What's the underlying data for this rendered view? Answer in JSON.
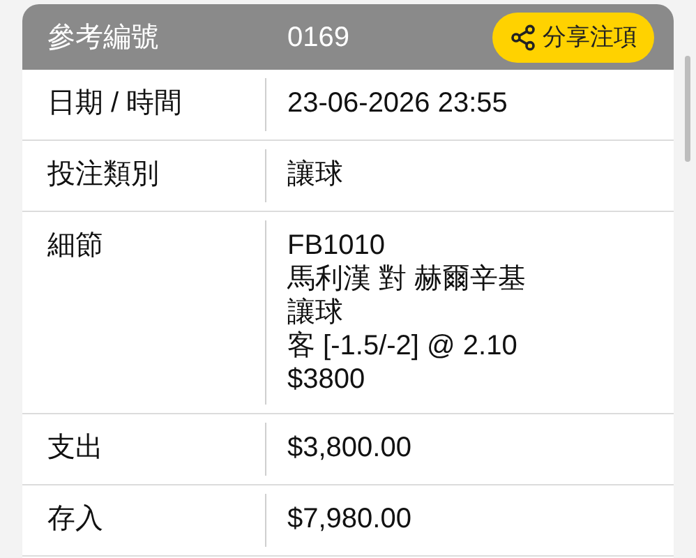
{
  "header": {
    "label": "參考編號",
    "value": "0169",
    "share_button": "分享注項"
  },
  "rows": [
    {
      "label": "日期 / 時間",
      "lines": [
        "23-06-2026 23:55"
      ]
    },
    {
      "label": "投注類別",
      "lines": [
        "讓球"
      ]
    },
    {
      "label": "細節",
      "lines": [
        "FB1010",
        "馬利漢 對 赫爾辛基",
        "讓球",
        "客 [-1.5/-2] @ 2.10",
        "$3800"
      ]
    },
    {
      "label": "支出",
      "lines": [
        "$3,800.00"
      ]
    },
    {
      "label": "存入",
      "lines": [
        "$7,980.00"
      ]
    }
  ]
}
